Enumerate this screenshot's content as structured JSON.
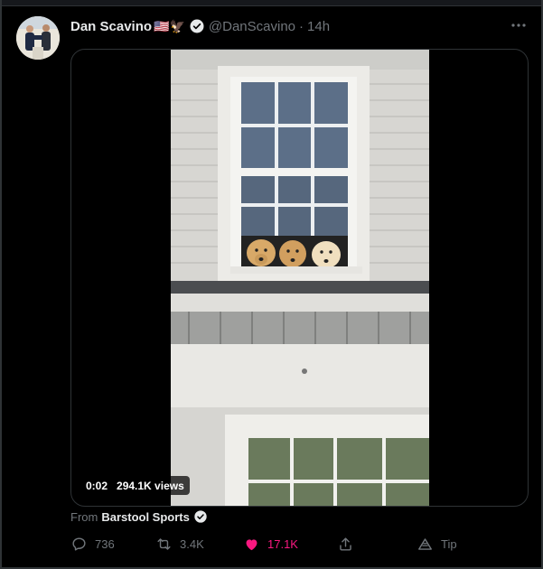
{
  "tweet": {
    "author_name": "Dan Scavino",
    "author_emoji": "🇺🇸🦅",
    "handle": "@DanScavino",
    "separator": "·",
    "time": "14h"
  },
  "media": {
    "video_time": "0:02",
    "views": "294.1K views"
  },
  "source": {
    "prefix": "From",
    "name": "Barstool Sports"
  },
  "actions": {
    "replies": "736",
    "retweets": "3.4K",
    "likes": "17.1K",
    "tip_label": "Tip"
  },
  "colors": {
    "background": "#000000",
    "text": "#e7e9ea",
    "muted": "#71767b",
    "like": "#f91880",
    "verified": "#e7e9ea"
  },
  "icons": [
    "more-icon",
    "verified-icon",
    "reply-icon",
    "retweet-icon",
    "like-icon",
    "share-icon",
    "tip-icon"
  ]
}
